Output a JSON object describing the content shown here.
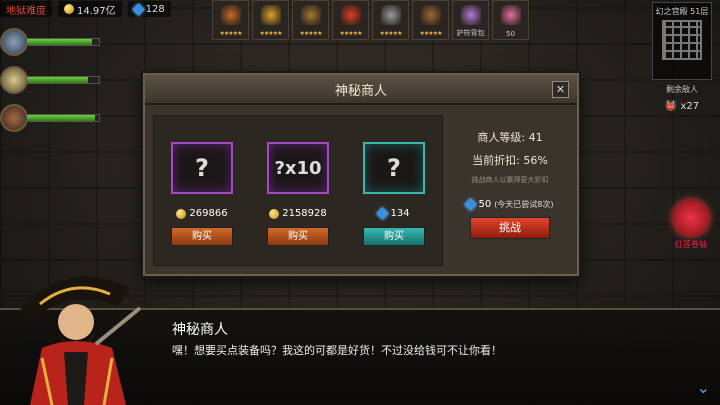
{
  "topbar": {
    "difficulty_label": "地狱难度",
    "gold": "14.97亿",
    "gems": "128"
  },
  "heroes": [
    {
      "hp": 0.9
    },
    {
      "hp": 0.85
    },
    {
      "hp": 0.95
    }
  ],
  "items": [
    {
      "name": "potion",
      "stars": "★★★★★",
      "label": "",
      "color": "#c06a2a"
    },
    {
      "name": "feather",
      "stars": "★★★★★",
      "label": "",
      "color": "#d8a030"
    },
    {
      "name": "helmet",
      "stars": "★★★★★",
      "label": "",
      "color": "#a07838"
    },
    {
      "name": "sword",
      "stars": "★★★★★",
      "label": "",
      "color": "#d8402a"
    },
    {
      "name": "beast",
      "stars": "★★★★★",
      "label": "",
      "color": "#9a9a9a"
    },
    {
      "name": "bag",
      "stars": "★★★★★",
      "label": "",
      "color": "#9a6a3a"
    },
    {
      "name": "backpack",
      "stars": "",
      "label": "护符背包",
      "color": "#b07ad0"
    },
    {
      "name": "gem-pouch",
      "stars": "",
      "label": "50",
      "color": "#e070a0"
    }
  ],
  "minimap": {
    "title": "幻之宫殿 51层"
  },
  "enemy": {
    "label": "剩余敌人",
    "count": "x27"
  },
  "side_scroll": {
    "label": "红莲卷轴"
  },
  "dialog": {
    "title": "神秘商人",
    "slots": [
      {
        "glyph": "?",
        "price": "269866",
        "currency": "gold",
        "buy_label": "购买"
      },
      {
        "glyph": "?x10",
        "price": "2158928",
        "currency": "gold",
        "buy_label": "购买"
      },
      {
        "glyph": "?",
        "price": "134",
        "currency": "gem",
        "buy_label": "购买"
      }
    ],
    "level_label": "商人等级:  41",
    "discount_label": "当前折扣:  56%",
    "hint": "挑战商人以赢得更大折扣",
    "challenge_cost": "50",
    "challenge_note": "(今天已尝试8次)",
    "challenge_label": "挑战"
  },
  "conversation": {
    "speaker": "神秘商人",
    "text": "嘿！想要买点装备吗？我这的可都是好货！不过没给钱可不让你看！"
  }
}
